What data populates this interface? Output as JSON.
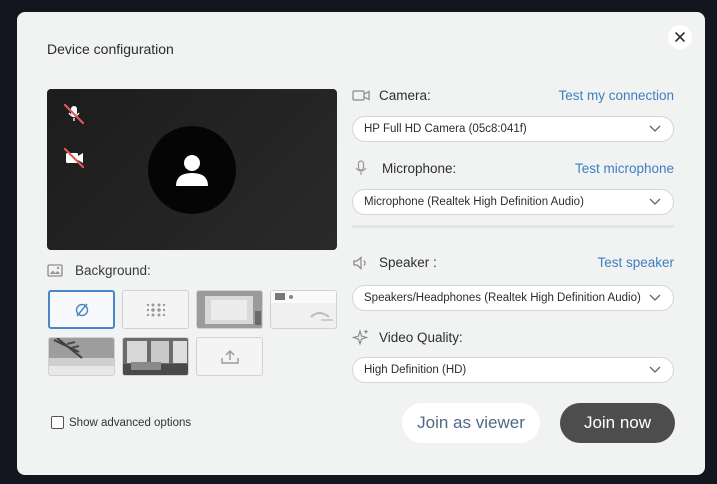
{
  "dialog": {
    "title": "Device configuration",
    "close_icon": "close-icon"
  },
  "preview": {
    "mic_status_icon": "microphone-muted-icon",
    "camera_status_icon": "camera-off-icon",
    "avatar_icon": "user-avatar-icon"
  },
  "background": {
    "label": "Background:",
    "icon": "image-icon",
    "options": [
      {
        "name": "none",
        "icon": "no-background-icon",
        "selected": true
      },
      {
        "name": "blur",
        "icon": "blur-dots-icon"
      },
      {
        "name": "white-room",
        "kind": "image"
      },
      {
        "name": "white-office",
        "kind": "image"
      },
      {
        "name": "beach",
        "kind": "image"
      },
      {
        "name": "living-room",
        "kind": "image"
      },
      {
        "name": "upload",
        "icon": "upload-icon"
      }
    ]
  },
  "advanced": {
    "label": "Show advanced options",
    "checked": false
  },
  "camera": {
    "icon": "camera-icon",
    "label": "Camera:",
    "link": "Test my connection",
    "value": "HP Full HD Camera (05c8:041f)"
  },
  "microphone": {
    "icon": "microphone-icon",
    "label": "Microphone:",
    "link": "Test microphone",
    "value": "Microphone (Realtek High Definition Audio)",
    "level": 0
  },
  "speaker": {
    "icon": "speaker-icon",
    "label": "Speaker :",
    "link": "Test speaker",
    "value": "Speakers/Headphones (Realtek High Definition Audio)"
  },
  "video_quality": {
    "icon": "sparkle-icon",
    "label": "Video Quality:",
    "value": "High Definition (HD)"
  },
  "actions": {
    "viewer_label": "Join as viewer",
    "join_label": "Join now"
  },
  "colors": {
    "link": "#3d7fc2",
    "selected_border": "#4a86c5",
    "join_button": "#4d4d4d",
    "mic_level": "#7bbf9c"
  }
}
